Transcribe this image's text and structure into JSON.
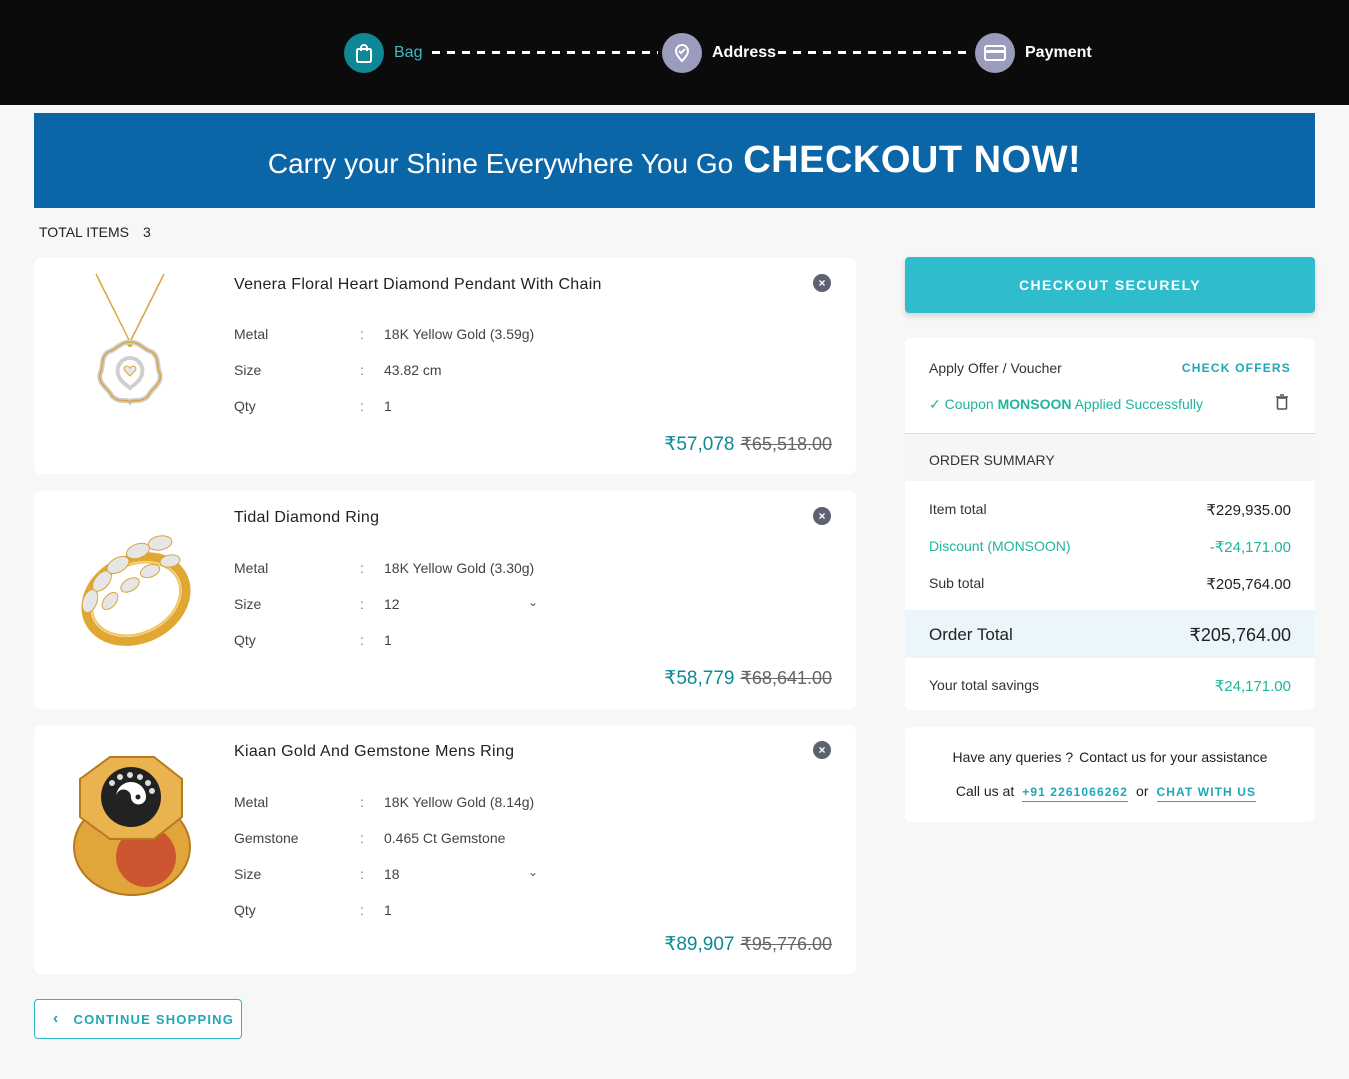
{
  "stepper": {
    "bag": "Bag",
    "address": "Address",
    "payment": "Payment"
  },
  "banner": {
    "text": "Carry your Shine Everywhere You Go",
    "cta": "CHECKOUT NOW!"
  },
  "cart": {
    "total_label": "TOTAL ITEMS",
    "total_count": "3"
  },
  "items": [
    {
      "title": "Venera Floral Heart Diamond Pendant With Chain",
      "specs": [
        {
          "k": "Metal",
          "v": "18K Yellow Gold (3.59g)"
        },
        {
          "k": "Size",
          "v": "43.82 cm"
        },
        {
          "k": "Qty",
          "v": "1"
        }
      ],
      "price": "₹57,078",
      "old_price": "₹65,518.00"
    },
    {
      "title": "Tidal Diamond Ring",
      "specs": [
        {
          "k": "Metal",
          "v": "18K Yellow Gold (3.30g)"
        },
        {
          "k": "Size",
          "v": "12"
        },
        {
          "k": "Qty",
          "v": "1"
        }
      ],
      "price": "₹58,779",
      "old_price": "₹68,641.00"
    },
    {
      "title": "Kiaan Gold And Gemstone Mens Ring",
      "specs": [
        {
          "k": "Metal",
          "v": "18K Yellow Gold (8.14g)"
        },
        {
          "k": "Gemstone",
          "v": "0.465 Ct Gemstone"
        },
        {
          "k": "Size",
          "v": "18"
        },
        {
          "k": "Qty",
          "v": "1"
        }
      ],
      "price": "₹89,907",
      "old_price": "₹95,776.00"
    }
  ],
  "continue_label": "CONTINUE SHOPPING",
  "checkout_label": "CHECKOUT SECURELY",
  "offer": {
    "label": "Apply Offer / Voucher",
    "check": "CHECK OFFERS",
    "coupon_prefix": "Coupon",
    "coupon_code": "MONSOON",
    "coupon_suffix": "Applied Successfully"
  },
  "summary": {
    "heading": "ORDER SUMMARY",
    "item_total_label": "Item total",
    "item_total": "₹229,935.00",
    "discount_label": "Discount (MONSOON)",
    "discount": "-₹24,171.00",
    "subtotal_label": "Sub total",
    "subtotal": "₹205,764.00",
    "order_total_label": "Order Total",
    "order_total": "₹205,764.00",
    "savings_label": "Your total savings",
    "savings": "₹24,171.00"
  },
  "help": {
    "q1": "Have any queries ?",
    "q2": "Contact us for your assistance",
    "call_label": "Call us at",
    "phone": "+91 2261066262",
    "or": "or",
    "chat": "CHAT WITH US"
  },
  "colors": {
    "accent": "#2fbccd",
    "banner": "#0b66a8",
    "success": "#1fb59b",
    "price": "#0b8a94"
  }
}
